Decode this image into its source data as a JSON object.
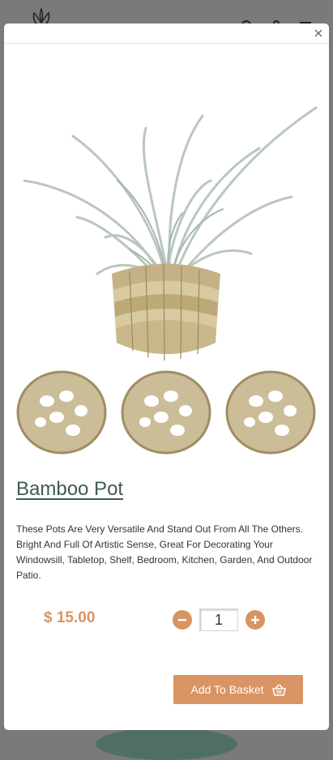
{
  "modal": {
    "product": {
      "title": "Bamboo Pot",
      "description": "These Pots Are Very Versatile And Stand Out From All The Others. Bright And Full Of Artistic Sense, Great For Decorating Your Windowsill, Tabletop, Shelf, Bedroom, Kitchen, Garden, And Outdoor Patio.",
      "price": "$ 15.00",
      "quantity": "1",
      "add_to_basket_label": "Add To Basket"
    },
    "icons": {
      "close": "close-icon",
      "minus": "minus-icon",
      "plus": "plus-icon",
      "basket": "basket-icon"
    }
  },
  "colors": {
    "accent": "#d99463",
    "title": "#3f5a57",
    "overlay": "#7a7a7a"
  }
}
